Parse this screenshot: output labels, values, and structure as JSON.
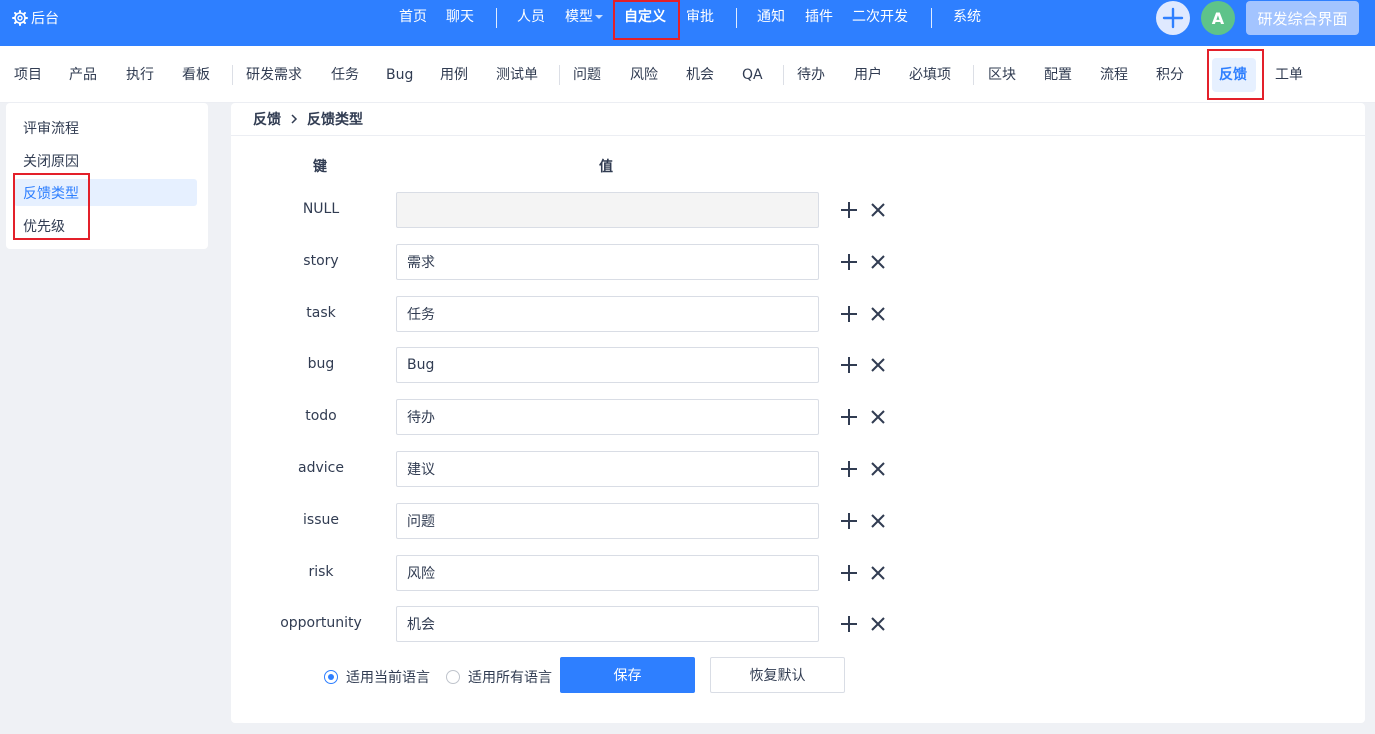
{
  "colors": {
    "primary": "#2e7fff",
    "highlight_box": "#e3202a",
    "avatar_bg": "#5ec38a"
  },
  "topbar": {
    "back_label": "后台",
    "back_icon": "gear-icon",
    "nav": [
      "首页",
      "聊天",
      "人员",
      "模型",
      "自定义",
      "审批",
      "通知",
      "插件",
      "二次开发",
      "系统"
    ],
    "active": "自定义",
    "avatar_letter": "A",
    "workspace_label": "研发综合界面"
  },
  "subnav": {
    "items": [
      "项目",
      "产品",
      "执行",
      "看板",
      "研发需求",
      "任务",
      "Bug",
      "用例",
      "测试单",
      "问题",
      "风险",
      "机会",
      "QA",
      "待办",
      "用户",
      "必填项",
      "区块",
      "配置",
      "流程",
      "积分",
      "反馈",
      "工单"
    ],
    "active": "反馈"
  },
  "sidemenu": {
    "items": [
      "评审流程",
      "关闭原因",
      "反馈类型",
      "优先级"
    ],
    "active": "反馈类型"
  },
  "breadcrumb": {
    "parent": "反馈",
    "current": "反馈类型"
  },
  "table": {
    "key_header": "键",
    "value_header": "值",
    "rows": [
      {
        "key": "NULL",
        "value": ""
      },
      {
        "key": "story",
        "value": "需求"
      },
      {
        "key": "task",
        "value": "任务"
      },
      {
        "key": "bug",
        "value": "Bug"
      },
      {
        "key": "todo",
        "value": "待办"
      },
      {
        "key": "advice",
        "value": "建议"
      },
      {
        "key": "issue",
        "value": "问题"
      },
      {
        "key": "risk",
        "value": "风险"
      },
      {
        "key": "opportunity",
        "value": "机会"
      }
    ]
  },
  "footer": {
    "radio_current": "适用当前语言",
    "radio_all": "适用所有语言",
    "radio_selected": "适用当前语言",
    "save_label": "保存",
    "reset_label": "恢复默认"
  }
}
